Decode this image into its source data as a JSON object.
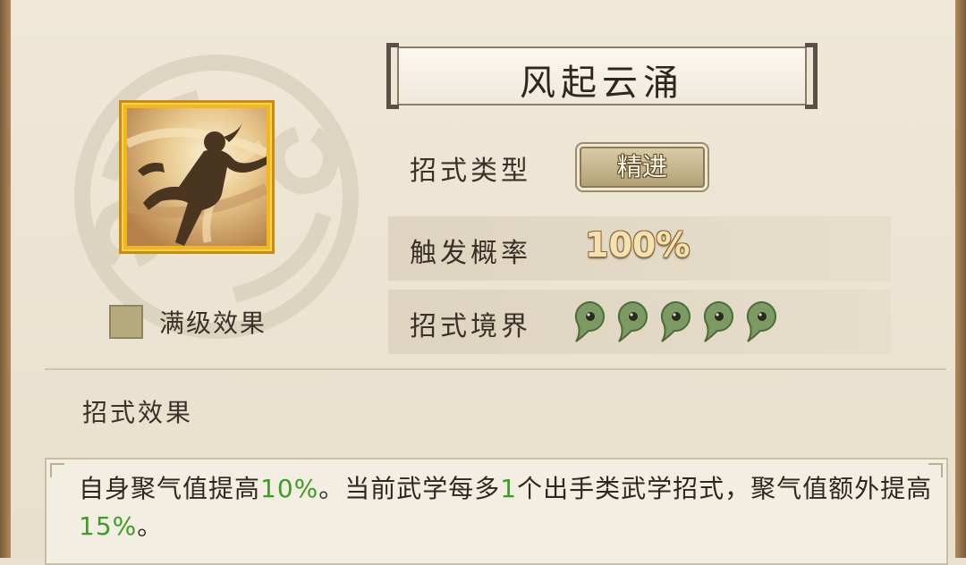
{
  "skill": {
    "name": "风起云涌",
    "max_level_label": "满级效果"
  },
  "info": {
    "type_label": "招式类型",
    "type_value": "精进",
    "rate_label": "触发概率",
    "rate_value": "100%",
    "realm_label": "招式境界",
    "realm_count": 5
  },
  "effect": {
    "title": "招式效果",
    "text_1": "自身聚气值提高",
    "value_1": "10%",
    "text_2": "。当前武学每多",
    "value_2": "1",
    "text_3": "个出手类武学招式，聚气值额外提高",
    "value_3": "15%",
    "text_4": "。"
  },
  "colors": {
    "highlight": "#3f9a2a",
    "icon_gold": "#f2b71b"
  }
}
